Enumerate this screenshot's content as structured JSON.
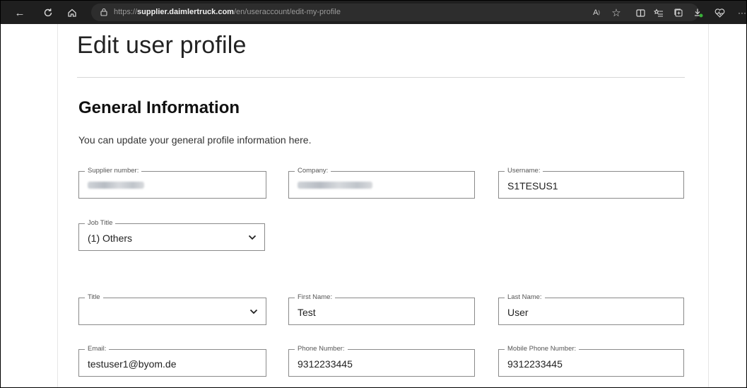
{
  "browser": {
    "url_prefix": "https://",
    "url_host": "supplier.daimlertruck.com",
    "url_path": "/en/useraccount/edit-my-profile"
  },
  "page": {
    "title": "Edit user profile",
    "section_title": "General Information",
    "section_desc": "You can update your general profile information here."
  },
  "fields": {
    "supplier_number": {
      "label": "Supplier number:"
    },
    "company": {
      "label": "Company:"
    },
    "username": {
      "label": "Username:",
      "value": "S1TESUS1"
    },
    "job_title": {
      "label": "Job Title",
      "value": "(1) Others"
    },
    "title": {
      "label": "Title",
      "value": ""
    },
    "first_name": {
      "label": "First Name:",
      "value": "Test"
    },
    "last_name": {
      "label": "Last Name:",
      "value": "User"
    },
    "email": {
      "label": "Email:",
      "value": "testuser1@byom.de"
    },
    "phone": {
      "label": "Phone Number:",
      "value": "9312233445"
    },
    "mobile": {
      "label": "Mobile Phone Number:",
      "value": "9312233445"
    }
  }
}
